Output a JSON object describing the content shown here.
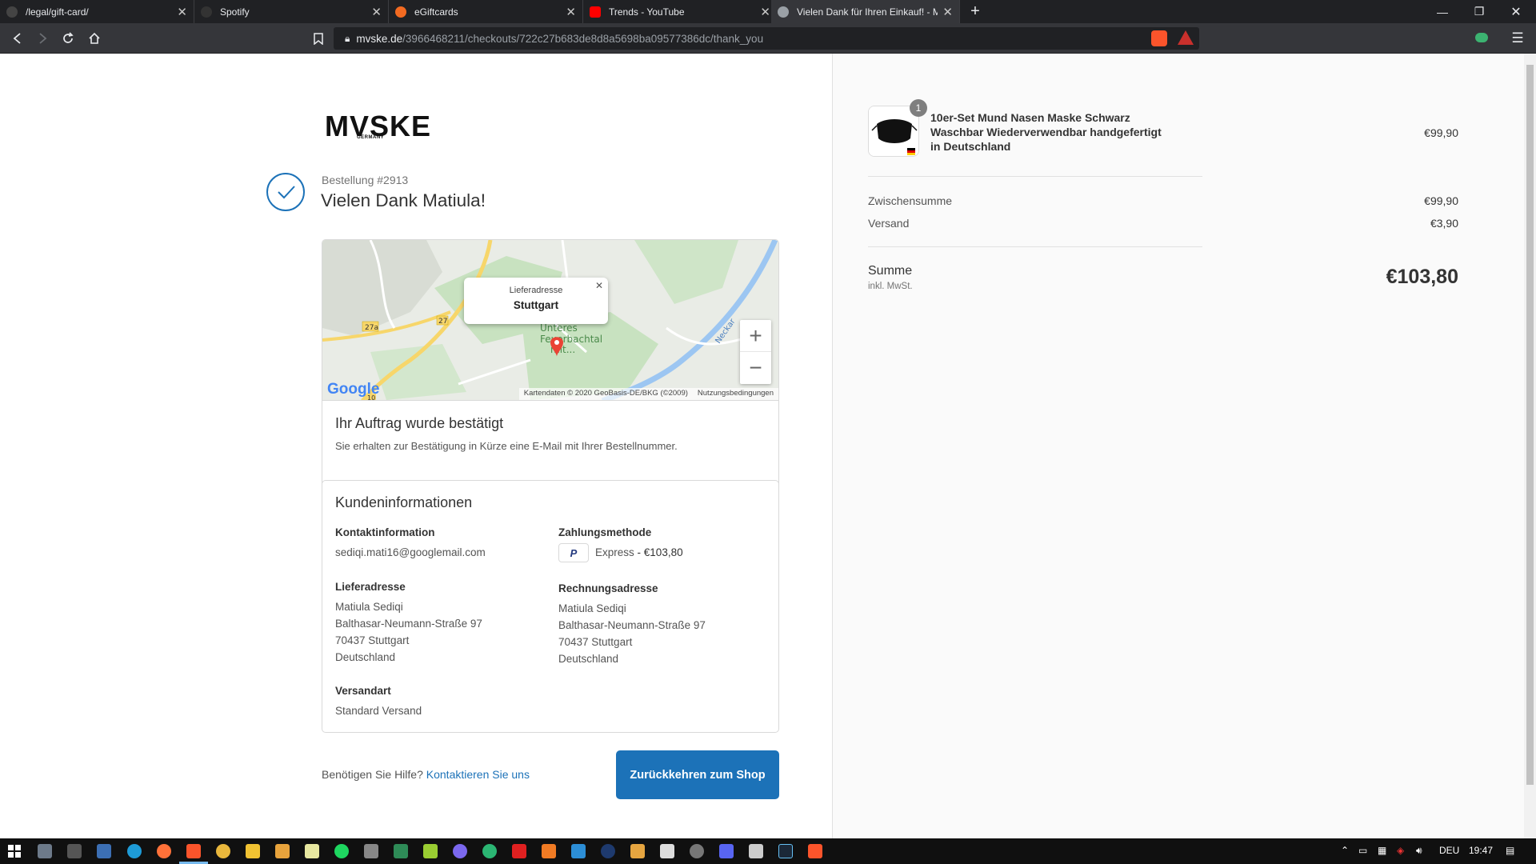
{
  "browser": {
    "tabs": [
      {
        "title": "/legal/gift-card/",
        "favicon_color": "#444444",
        "active": false
      },
      {
        "title": "Spotify",
        "favicon_color": "#333333",
        "active": false
      },
      {
        "title": "eGiftcards",
        "favicon_color": "#f26a21",
        "active": false
      },
      {
        "title": "Trends - YouTube",
        "favicon_color": "#ff0000",
        "active": false
      },
      {
        "title": "Vielen Dank für Ihren Einkauf! - M",
        "favicon_color": "#9aa0a6",
        "active": true
      }
    ],
    "url_host": "mvske.de",
    "url_path": "/3966468211/checkouts/722c27b683de8d8a5698ba09577386dc/thank_you"
  },
  "page": {
    "logo": "MVSKE",
    "logo_sub": "GERMANY",
    "order_number": "Bestellung #2913",
    "thanks": "Vielen Dank Matiula!",
    "map": {
      "popup_label": "Lieferadresse",
      "popup_city": "Stuttgart",
      "google": "Google",
      "attribution": "Kartendaten © 2020 GeoBasis-DE/BKG (©2009)",
      "terms": "Nutzungsbedingungen",
      "zoom_in": "+",
      "zoom_out": "−"
    },
    "confirmation": {
      "title": "Ihr Auftrag wurde bestätigt",
      "text": "Sie erhalten zur Bestätigung in Kürze eine E-Mail mit Ihrer Bestellnummer."
    },
    "customer": {
      "title": "Kundeninformationen",
      "contact_heading": "Kontaktinformation",
      "email": "sediqi.mati16@googlemail.com",
      "payment_heading": "Zahlungsmethode",
      "payment_icon": "paypal-icon",
      "payment_method": "Express",
      "payment_amount": "- €103,80",
      "shipping_heading": "Lieferadresse",
      "shipping_address": [
        "Matiula Sediqi",
        "Balthasar-Neumann-Straße 97",
        "70437 Stuttgart",
        "Deutschland"
      ],
      "billing_heading": "Rechnungsadresse",
      "billing_address": [
        "Matiula Sediqi",
        "Balthasar-Neumann-Straße 97",
        "70437 Stuttgart",
        "Deutschland"
      ],
      "shipping_method_heading": "Versandart",
      "shipping_method": "Standard Versand"
    },
    "help_text": "Benötigen Sie Hilfe?",
    "help_link": "Kontaktieren Sie uns",
    "back_button": "Zurückkehren zum Shop"
  },
  "summary": {
    "product_name": "10er-Set Mund Nasen Maske Schwarz Waschbar Wiederverwendbar handgefertigt in Deutschland",
    "product_qty": "1",
    "product_price": "€99,90",
    "subtotal_label": "Zwischensumme",
    "subtotal": "€99,90",
    "shipping_label": "Versand",
    "shipping": "€3,90",
    "total_label": "Summe",
    "total_sub": "inkl. MwSt.",
    "total": "€103,80"
  },
  "taskbar": {
    "language": "DEU",
    "time": "19:47"
  },
  "colors": {
    "accent": "#1c72b8",
    "browser_dark": "#202124"
  }
}
